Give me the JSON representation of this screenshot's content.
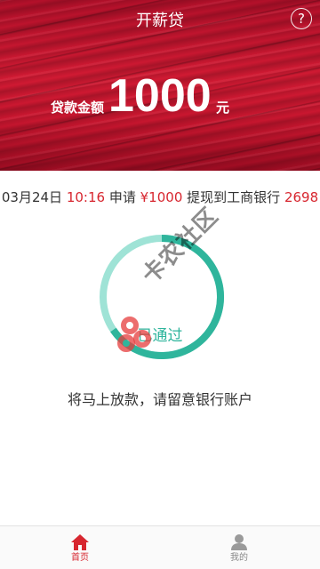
{
  "header": {
    "title": "开薪贷",
    "help_icon": "question-circle-icon",
    "help_glyph": "?"
  },
  "loan": {
    "label": "贷款金额",
    "amount": "1000",
    "unit": "元"
  },
  "application": {
    "date": "03月24日",
    "time": "10:16",
    "verb": "申请",
    "amount": "¥1000",
    "action": "提现到工商银行",
    "card_last4": "2698"
  },
  "status": {
    "text": "已通过",
    "ring_color": "#2fb59c",
    "ring_light_color": "#9fe3d6"
  },
  "notice": "将马上放款，请留意银行账户",
  "watermark": {
    "text": "卡农社区"
  },
  "tabbar": {
    "items": [
      {
        "label": "首页",
        "icon": "home-icon",
        "active": true
      },
      {
        "label": "我的",
        "icon": "user-icon",
        "active": false
      }
    ]
  },
  "colors": {
    "brand_red": "#d11a33",
    "highlight_red": "#d7262f"
  }
}
